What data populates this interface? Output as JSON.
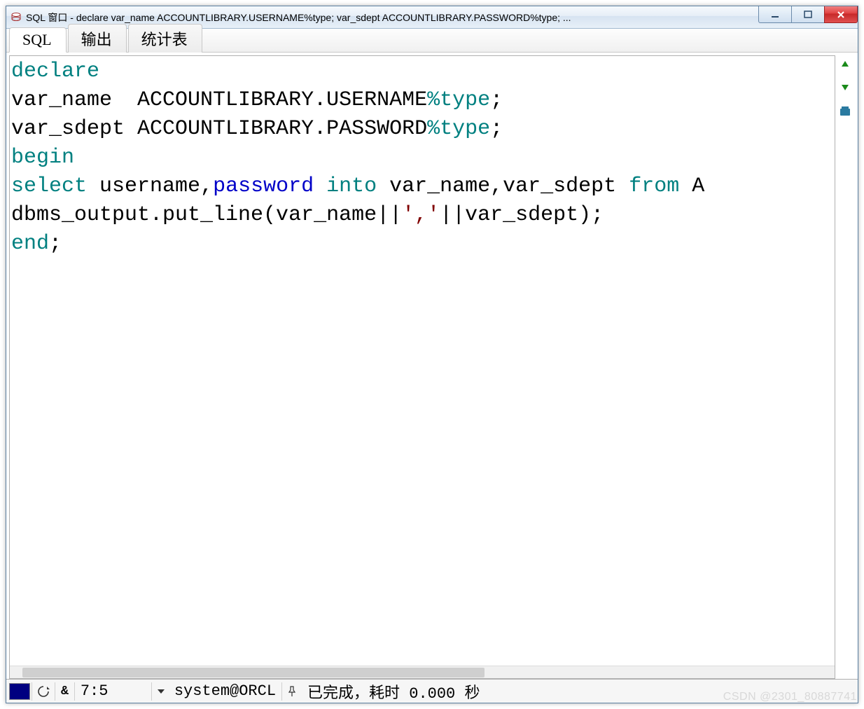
{
  "window": {
    "title": "SQL 窗口 - declare var_name ACCOUNTLIBRARY.USERNAME%type; var_sdept ACCOUNTLIBRARY.PASSWORD%type; ..."
  },
  "tabs": [
    {
      "label": "SQL"
    },
    {
      "label": "输出"
    },
    {
      "label": "统计表"
    }
  ],
  "code": {
    "line1": {
      "t1": "declare"
    },
    "line2": {
      "t1": "var_name  ACCOUNTLIBRARY.USERNAME",
      "t2": "%type",
      "t3": ";"
    },
    "line3": {
      "t1": "var_sdept ACCOUNTLIBRARY.PASSWORD",
      "t2": "%type",
      "t3": ";"
    },
    "line4": {
      "t1": "begin"
    },
    "line5": {
      "t1": "select",
      "t2": " username,",
      "t3": "password",
      "t4": " ",
      "t5": "into",
      "t6": " var_name,var_sdept ",
      "t7": "from",
      "t8": " A"
    },
    "line6": {
      "t1": "dbms_output.put_line(var_name||",
      "t2": "','",
      "t3": "||var_sdept);"
    },
    "line7": {
      "t1": "end",
      "t2": ";"
    }
  },
  "status": {
    "anchor_char": "&",
    "cursor": "7:5",
    "connection": "system@ORCL",
    "message": "已完成，耗时 0.000 秒"
  },
  "watermark": "CSDN @2301_80887741"
}
